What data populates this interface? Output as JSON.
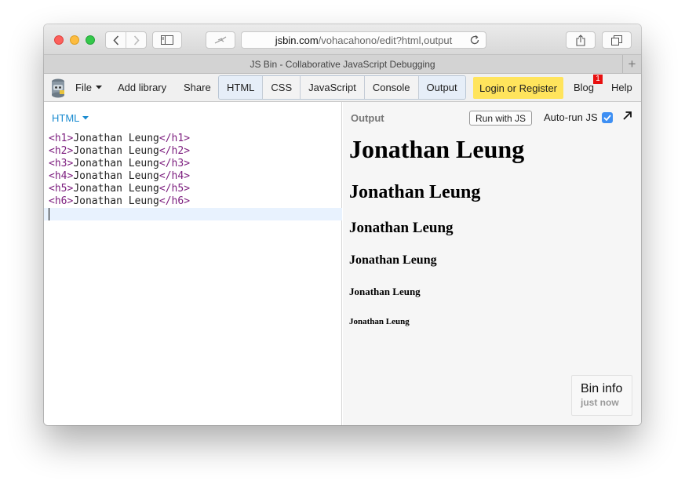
{
  "browser": {
    "url_domain": "jsbin.com",
    "url_path": "/vohacahono/edit?html,output",
    "tab_title": "JS Bin - Collaborative JavaScript Debugging",
    "new_tab": "+"
  },
  "menubar": {
    "file": "File",
    "add_library": "Add library",
    "share": "Share",
    "panels": [
      "HTML",
      "CSS",
      "JavaScript",
      "Console",
      "Output"
    ],
    "login": "Login or Register",
    "blog": "Blog",
    "blog_badge": "1",
    "help": "Help"
  },
  "editor": {
    "language": "HTML",
    "lines": [
      {
        "open": "<h1>",
        "text": "Jonathan Leung",
        "close": "</h1>"
      },
      {
        "open": "<h2>",
        "text": "Jonathan Leung",
        "close": "</h2>"
      },
      {
        "open": "<h3>",
        "text": "Jonathan Leung",
        "close": "</h3>"
      },
      {
        "open": "<h4>",
        "text": "Jonathan Leung",
        "close": "</h4>"
      },
      {
        "open": "<h5>",
        "text": "Jonathan Leung",
        "close": "</h5>"
      },
      {
        "open": "<h6>",
        "text": "Jonathan Leung",
        "close": "</h6>"
      }
    ]
  },
  "output": {
    "label": "Output",
    "run_button": "Run with JS",
    "autorun_label": "Auto-run JS",
    "autorun_checked": true,
    "headings": [
      "Jonathan Leung",
      "Jonathan Leung",
      "Jonathan Leung",
      "Jonathan Leung",
      "Jonathan Leung",
      "Jonathan Leung"
    ],
    "bin_info_title": "Bin info",
    "bin_info_time": "just now"
  },
  "colors": {
    "accent_blue": "#1a8bd0",
    "login_yellow": "#ffe45c",
    "tag_purple": "#7c1d7e",
    "badge_red": "#e81010",
    "checkbox_blue": "#3e8ff3"
  }
}
